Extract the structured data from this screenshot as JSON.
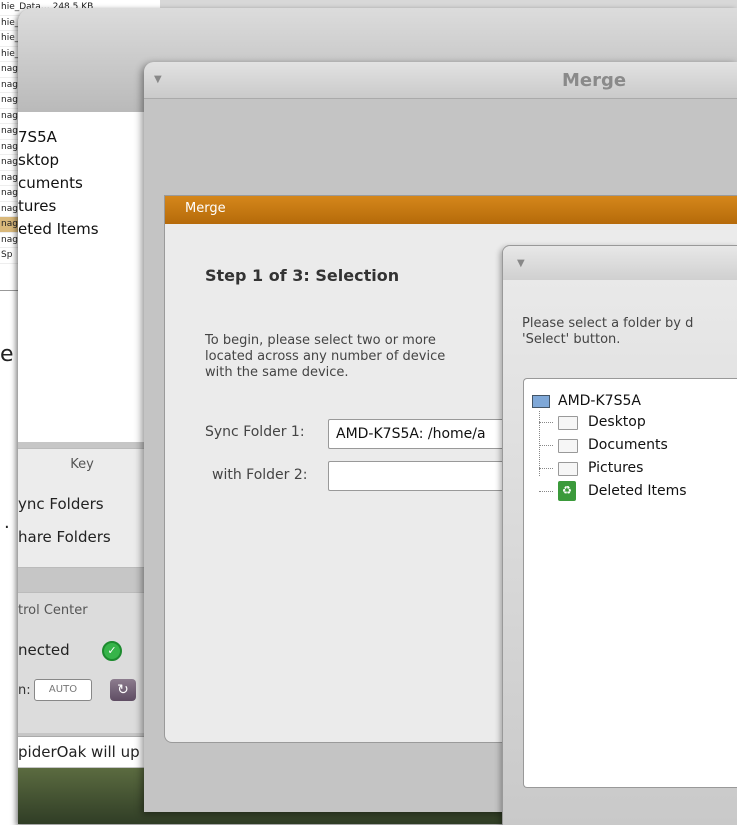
{
  "file_list": {
    "rows": [
      "hie_Data…   248.5 KB",
      "hie_",
      "hie_",
      "hie_",
      "nag",
      "nag",
      "nag",
      "nag",
      "nag",
      "nag",
      "nag",
      "nag",
      "nag",
      "nag",
      "nag",
      "nag",
      "Sp"
    ]
  },
  "back_window": {
    "tree_items": [
      "7S5A",
      "sktop",
      "cuments",
      "tures",
      "eted Items"
    ],
    "key_title": "Key",
    "key_items": [
      "ync Folders",
      "hare Folders"
    ],
    "control_center_title": "trol Center",
    "status_text": "nected",
    "status_icon": "check-circle-icon",
    "schedule_label": "n:",
    "schedule_value": "AUTO",
    "refresh_icon": "refresh-icon",
    "bottom_message": "piderOak will up",
    "edge_char": "e",
    "edge_dot": "."
  },
  "merge_window": {
    "title": "Merge",
    "inner_header": "Merge",
    "step_title": "Step 1 of 3: Selection",
    "instructions": "To begin, please select two or more\nlocated across any number of device\nwith the same device.",
    "sync_folder_1_label": "Sync Folder 1:",
    "sync_folder_1_value": "AMD-K7S5A: /home/a",
    "with_folder_2_label": "with Folder 2:",
    "with_folder_2_value": ""
  },
  "folder_chooser": {
    "instructions": "Please select a folder by d\n'Select' button.",
    "root": "AMD-K7S5A",
    "children": [
      "Desktop",
      "Documents",
      "Pictures",
      "Deleted Items"
    ]
  },
  "colors": {
    "accent_orange": "#c77914",
    "ok_green": "#36b449"
  }
}
